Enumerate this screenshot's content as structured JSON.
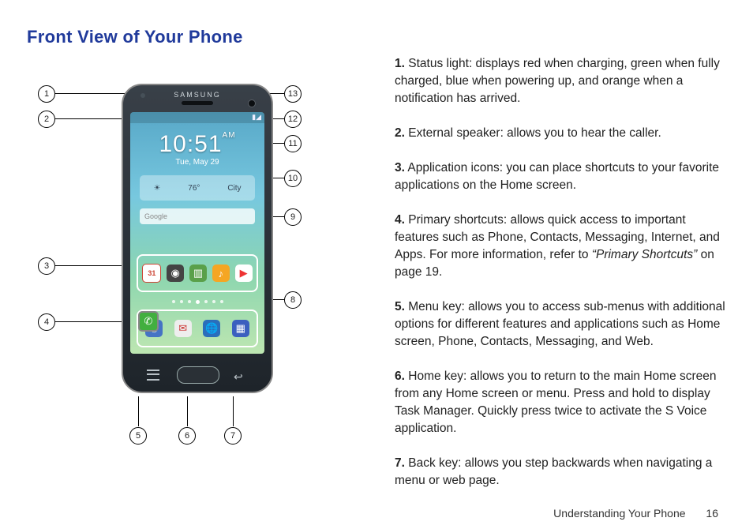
{
  "heading": "Front View of Your Phone",
  "footer": {
    "section": "Understanding Your Phone",
    "page": "16"
  },
  "phone": {
    "brand": "SAMSUNG",
    "status_time": "",
    "clock": "10:51",
    "clock_ampm": "AM",
    "date": "Tue, May 29",
    "weather": {
      "temp": "76°",
      "city": "City"
    },
    "search_placeholder": "Google",
    "row1_icons": [
      "calendar-icon",
      "camera-icon",
      "books-icon",
      "music-icon",
      "play-store-icon"
    ],
    "row1_labels": {
      "cal_date": "31"
    },
    "row2_icons": [
      "phone-icon",
      "contacts-icon",
      "messaging-icon",
      "internet-icon",
      "apps-icon"
    ]
  },
  "callouts": {
    "n1": "1",
    "n2": "2",
    "n3": "3",
    "n4": "4",
    "n5": "5",
    "n6": "6",
    "n7": "7",
    "n8": "8",
    "n9": "9",
    "n10": "10",
    "n11": "11",
    "n12": "12",
    "n13": "13"
  },
  "list": [
    {
      "num": "1.",
      "term": "Status light",
      "desc": ": displays red when charging, green when fully charged, blue when powering up, and orange when a notification has arrived."
    },
    {
      "num": "2.",
      "term": "External speaker",
      "desc": ": allows you to hear the caller."
    },
    {
      "num": "3.",
      "term": "Application icons",
      "desc": ": you can place shortcuts to your favorite applications on the Home screen."
    },
    {
      "num": "4.",
      "term": "Primary shortcuts",
      "desc": ": allows quick access to important features such as Phone, Contacts, Messaging, Internet, and Apps. For more information, refer to ",
      "ref": "“Primary Shortcuts”",
      "tail": "  on page 19."
    },
    {
      "num": "5.",
      "term": "Menu key",
      "desc": ": allows you to access sub-menus with additional options for different features and applications such as Home screen, Phone, Contacts, Messaging, and Web."
    },
    {
      "num": "6.",
      "term": "Home key",
      "desc": ": allows you to return to the main Home screen from any Home screen or menu. Press and hold to display Task Manager. Quickly press twice to activate the S Voice application."
    },
    {
      "num": "7.",
      "term": "Back key",
      "desc": ": allows you step backwards when navigating a menu or web page."
    }
  ]
}
